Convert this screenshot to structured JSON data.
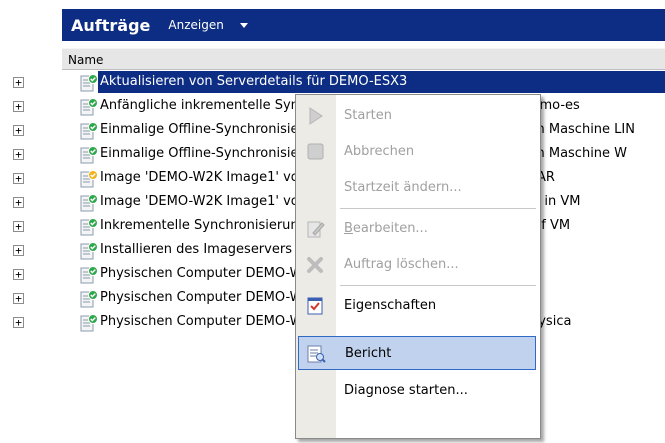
{
  "header": {
    "title": "Aufträge",
    "view_label": "Anzeigen"
  },
  "table": {
    "column": "Name",
    "rows": [
      {
        "text": "Aktualisieren von Serverdetails für DEMO-ESX3",
        "icon": "job-ok-icon",
        "selected": true
      },
      {
        "text": "Anfängliche inkrementelle Synchronisierung von DEMO-W2K mit demo-es",
        "icon": "job-ok-icon"
      },
      {
        "text": "Einmalige Offline-Synchronisierung von DEMO-W2K in den virtuellen Maschine LIN",
        "icon": "job-ok-icon"
      },
      {
        "text": "Einmalige Offline-Synchronisierung von DEMO-W2K in den virtuellen Maschine W",
        "icon": "job-ok-icon"
      },
      {
        "text": "Image 'DEMO-W2K Image1' von DEMO-W2K1 auf Server PHYSICALTAR",
        "icon": "job-warning-icon"
      },
      {
        "text": "Image 'DEMO-W2K Image1' von DEMO-W2K1 erstellen DEMO-W2K1 in VM",
        "icon": "job-ok-icon"
      },
      {
        "text": "Inkrementelle Synchronisierung von DEMO-W2K mit DEMO-ESX3 auf VM",
        "icon": "job-ok-icon"
      },
      {
        "text": "Installieren des Imageservers",
        "icon": "job-ok-icon"
      },
      {
        "text": "Physischen Computer DEMO-W2K2 in virtuelle Maschine DEMO-F",
        "icon": "job-ok-icon"
      },
      {
        "text": "Physischen Computer DEMO-W2K Image1' in Pla",
        "icon": "job-ok-icon"
      },
      {
        "text": "Physischen Computer DEMO-W2K3 in den physischen Computer Physica",
        "icon": "job-ok-icon"
      }
    ]
  },
  "context_menu": {
    "items": [
      {
        "label": "Starten",
        "icon": "play-icon",
        "disabled": true
      },
      {
        "label": "Abbrechen",
        "icon": "stop-icon",
        "disabled": true
      },
      {
        "label": "Startzeit ändern...",
        "icon": "",
        "disabled": true
      },
      {
        "label_underline": "B",
        "label_rest": "earbeiten...",
        "icon": "edit-icon",
        "disabled": true
      },
      {
        "label": "Auftrag löschen...",
        "icon": "delete-icon",
        "disabled": true
      },
      {
        "label": "Eigenschaften",
        "icon": "properties-icon",
        "disabled": false
      },
      {
        "label": "Bericht",
        "icon": "report-icon",
        "disabled": false,
        "highlighted": true
      },
      {
        "label": "Diagnose starten...",
        "icon": "",
        "disabled": false
      }
    ]
  },
  "colors": {
    "selection": "#0c2d83",
    "menu_highlight": "#c1d2ee",
    "menu_highlight_border": "#3169c6"
  }
}
